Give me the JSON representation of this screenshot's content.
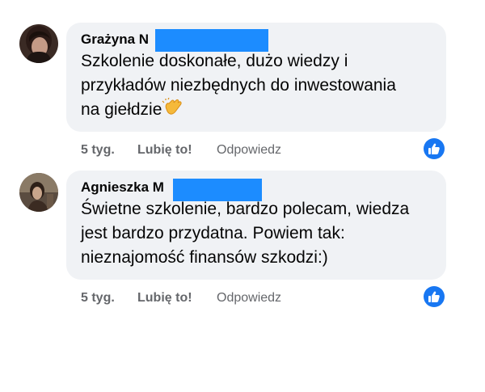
{
  "comments": [
    {
      "author": "Grażyna N",
      "text_lines": [
        "Szkolenie doskonałe, dużo wiedzy i",
        "przykładów niezbędnych do inwestowania",
        "na giełdzie"
      ],
      "emoji": "clapping-hands-icon",
      "time": "5 tyg.",
      "like_label": "Lubię to!",
      "reply_label": "Odpowiedz"
    },
    {
      "author": "Agnieszka M",
      "text_lines": [
        "Świetne szkolenie, bardzo polecam, wiedza",
        "jest bardzo przydatna. Powiem tak:",
        "nieznajomość finansów szkodzi:)"
      ],
      "time": "5 tyg.",
      "like_label": "Lubię to!",
      "reply_label": "Odpowiedz"
    }
  ],
  "colors": {
    "bubble": "#f0f2f5",
    "redaction": "#1c8cff",
    "like_badge": "#1877f2",
    "meta_text": "#65676b"
  }
}
